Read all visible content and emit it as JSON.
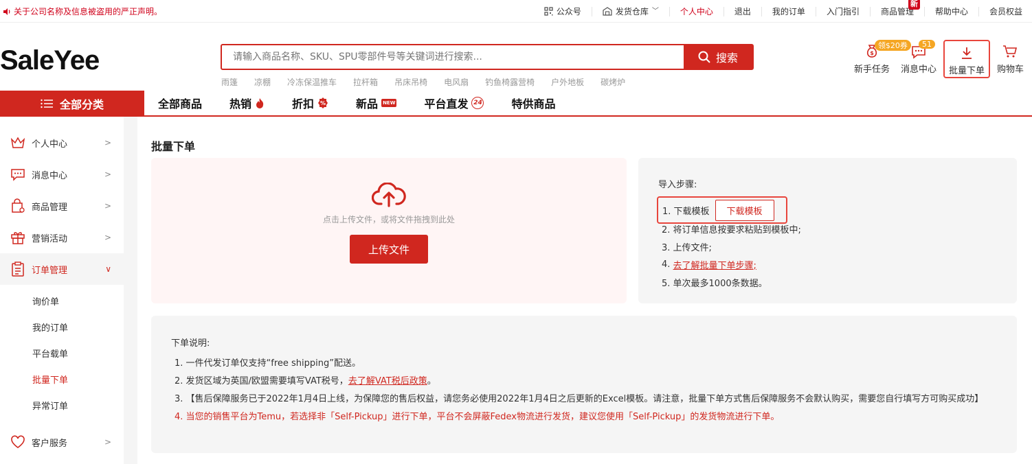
{
  "topbar": {
    "notice": "关于公司名称及信息被盗用的严正声明。",
    "items": [
      {
        "label": "公众号"
      },
      {
        "label": "发货仓库"
      },
      {
        "label": "个人中心"
      },
      {
        "label": "退出"
      },
      {
        "label": "我的订单"
      },
      {
        "label": "入门指引"
      },
      {
        "label": "商品管理",
        "badge": "新"
      },
      {
        "label": "帮助中心"
      },
      {
        "label": "会员权益"
      }
    ]
  },
  "header": {
    "logo": "SaleYee",
    "search_placeholder": "请输入商品名称、SKU、SPU零部件号等关键词进行搜索...",
    "search_button": "搜索",
    "hotwords": [
      "雨篷",
      "凉棚",
      "冷冻保温推车",
      "拉杆箱",
      "吊床吊椅",
      "电风扇",
      "钓鱼椅露营椅",
      "户外地板",
      "碳烤炉"
    ],
    "icons": [
      {
        "label": "新手任务",
        "badge": "领$20券"
      },
      {
        "label": "消息中心",
        "badge": "51"
      },
      {
        "label": "批量下单"
      },
      {
        "label": "购物车"
      }
    ]
  },
  "nav": {
    "all_categories": "全部分类",
    "items": [
      "全部商品",
      "热销",
      "折扣",
      "新品",
      "平台直发",
      "特供商品"
    ],
    "new_tag": "NEW",
    "direct_tag": "24"
  },
  "sidebar": {
    "items": [
      {
        "label": "个人中心"
      },
      {
        "label": "消息中心"
      },
      {
        "label": "商品管理"
      },
      {
        "label": "营销活动"
      },
      {
        "label": "订单管理"
      }
    ],
    "subitems": [
      "询价单",
      "我的订单",
      "平台载单",
      "批量下单",
      "异常订单"
    ],
    "bottom_item": "客户服务"
  },
  "main": {
    "title": "批量下单",
    "upload": {
      "hint": "点击上传文件，或将文件拖拽到此处",
      "button": "上传文件"
    },
    "steps": {
      "title": "导入步骤:",
      "step1": "1. 下载模板",
      "download_button": "下载模板",
      "step2": "2. 将订单信息按要求粘贴到模板中;",
      "step3": "3. 上传文件;",
      "step4_prefix": "4. ",
      "step4_link": "去了解批量下单步骤;",
      "step5": "5. 单次最多1000条数据。"
    },
    "notes": {
      "title": "下单说明:",
      "n1": "1. 一件代发订单仅支持“free shipping”配送。",
      "n2_prefix": "2. 发货区域为英国/欧盟需要填写VAT税号，",
      "n2_link": "去了解VAT税后政策",
      "n2_suffix": "。",
      "n3": "3. 【售后保障服务已于2022年1月4日上线，为保障您的售后权益，请您务必使用2022年1月4日之后更新的Excel模板。请注意，批量下单方式售后保障服务不会默认购买，需要您自行填写方可购买成功】",
      "n4": "4. 当您的销售平台为Temu，若选择非「Self-Pickup」进行下单，平台不会屏蔽Fedex物流进行发货，建议您使用「Self-Pickup」的发货物流进行下单。"
    }
  },
  "colors": {
    "accent": "#d0271f",
    "highlight_border": "#e8453c",
    "badge_orange": "#f5a623"
  }
}
